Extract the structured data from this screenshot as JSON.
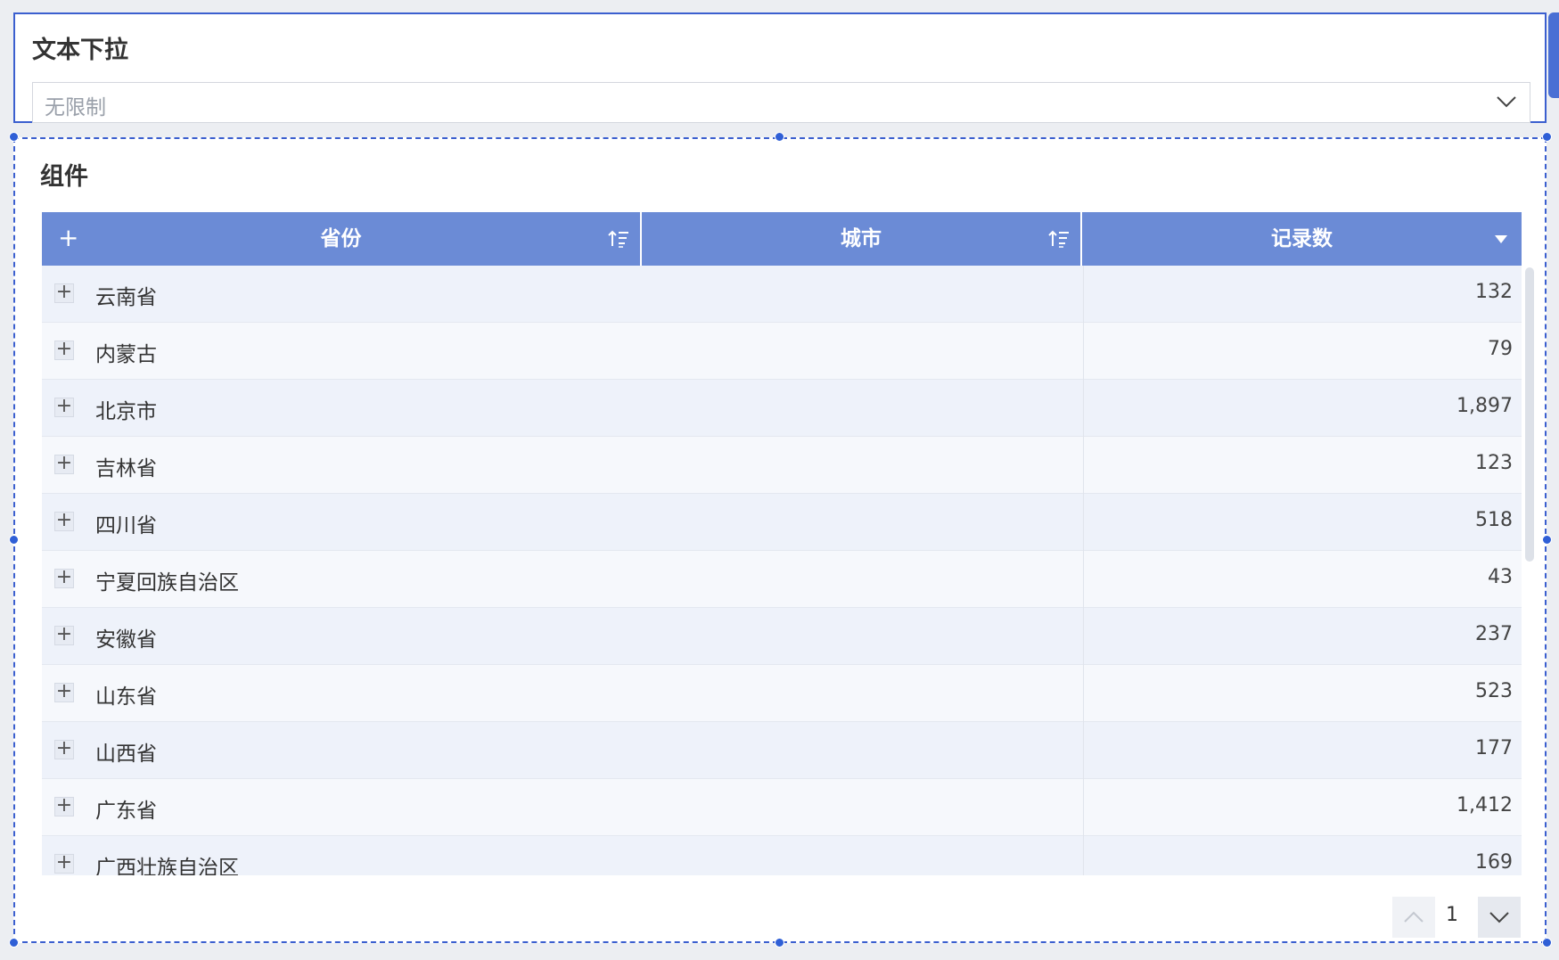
{
  "filter": {
    "title": "文本下拉",
    "dropdown_value": "无限制",
    "chevron_icon": "chevron-down-icon"
  },
  "component": {
    "title": "组件",
    "table": {
      "columns": [
        {
          "label": "省份",
          "icon": "sort-ascending-icon"
        },
        {
          "label": "城市",
          "icon": "sort-ascending-icon"
        },
        {
          "label": "记录数",
          "icon": "caret-down-icon"
        }
      ],
      "header_expand": "+",
      "rows": [
        {
          "province": "云南省",
          "count": "132"
        },
        {
          "province": "内蒙古",
          "count": "79"
        },
        {
          "province": "北京市",
          "count": "1,897"
        },
        {
          "province": "吉林省",
          "count": "123"
        },
        {
          "province": "四川省",
          "count": "518"
        },
        {
          "province": "宁夏回族自治区",
          "count": "43"
        },
        {
          "province": "安徽省",
          "count": "237"
        },
        {
          "province": "山东省",
          "count": "523"
        },
        {
          "province": "山西省",
          "count": "177"
        },
        {
          "province": "广东省",
          "count": "1,412"
        },
        {
          "province": "广西壮族自治区",
          "count": "169"
        }
      ],
      "row_expand": "+"
    },
    "pager": {
      "page": "1"
    }
  },
  "colors": {
    "header_bg": "#6b8bd6",
    "selection": "#3b5fcf",
    "row_odd": "#eef2fa",
    "row_even": "#f6f8fc"
  }
}
